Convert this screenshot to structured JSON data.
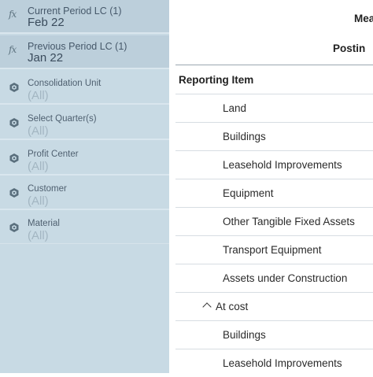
{
  "filters": [
    {
      "name": "Current Period LC (1)",
      "value": "Feb 22",
      "icon": "fx-icon"
    },
    {
      "name": "Previous Period LC (1)",
      "value": "Jan 22",
      "icon": "fx-icon"
    },
    {
      "name": "Consolidation Unit",
      "value": "(All)",
      "icon": "dimension-icon"
    },
    {
      "name": "Select Quarter(s)",
      "value": "(All)",
      "icon": "dimension-icon"
    },
    {
      "name": "Profit Center",
      "value": "(All)",
      "icon": "dimension-icon"
    },
    {
      "name": "Customer",
      "value": "(All)",
      "icon": "dimension-icon"
    },
    {
      "name": "Material",
      "value": "(All)",
      "icon": "dimension-icon"
    }
  ],
  "report": {
    "header_measure": "Mea",
    "header_posting": "Postin",
    "title": "Reporting Item",
    "rows": [
      "Land",
      "Buildings",
      "Leasehold Improvements",
      "Equipment",
      "Other Tangible Fixed Assets",
      "Transport Equipment",
      "Assets under Construction",
      "At cost",
      "Buildings",
      "Leasehold Improvements"
    ]
  }
}
